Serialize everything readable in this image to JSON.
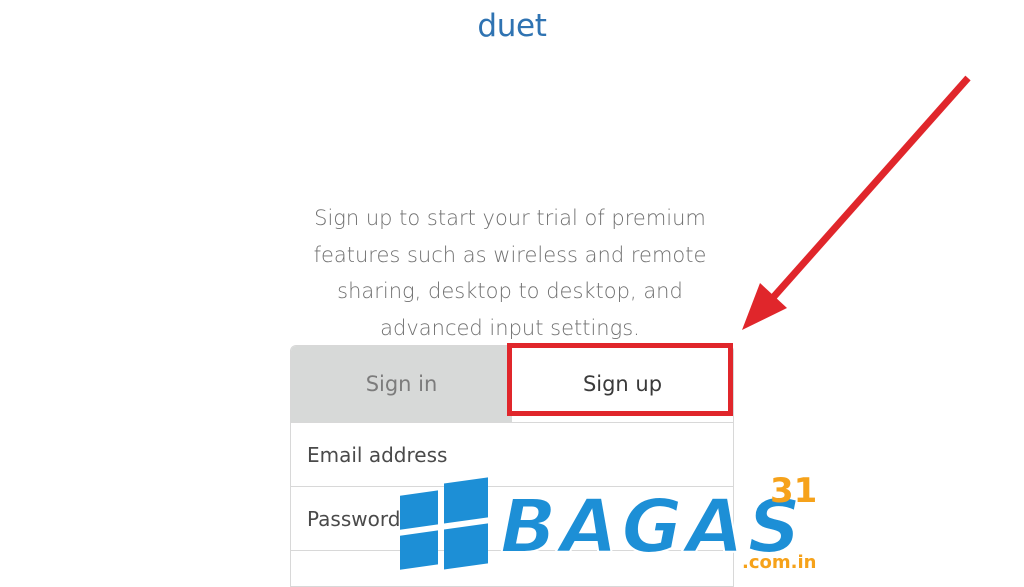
{
  "header": {
    "logo_text": "duet"
  },
  "intro": {
    "lines": [
      "Sign up to start your trial of premium",
      "features such as wireless and remote",
      "sharing, desktop to desktop, and",
      "advanced input settings."
    ]
  },
  "tabs": {
    "signin_label": "Sign in",
    "signup_label": "Sign up",
    "active": "signup"
  },
  "form": {
    "email_placeholder": "Email address",
    "email_value": "",
    "password_placeholder": "Password",
    "password_value": ""
  },
  "annotation": {
    "arrow_color": "#e0262b",
    "highlight_color": "#e0262b"
  },
  "watermark": {
    "text": "BAGAS",
    "superscript": "31",
    "domain": ".com.in",
    "text_color": "#1d8fd6",
    "accent_color": "#f6a21a"
  },
  "colors": {
    "brand": "#2f73b2",
    "tab_inactive_bg": "#d7d9d8"
  }
}
